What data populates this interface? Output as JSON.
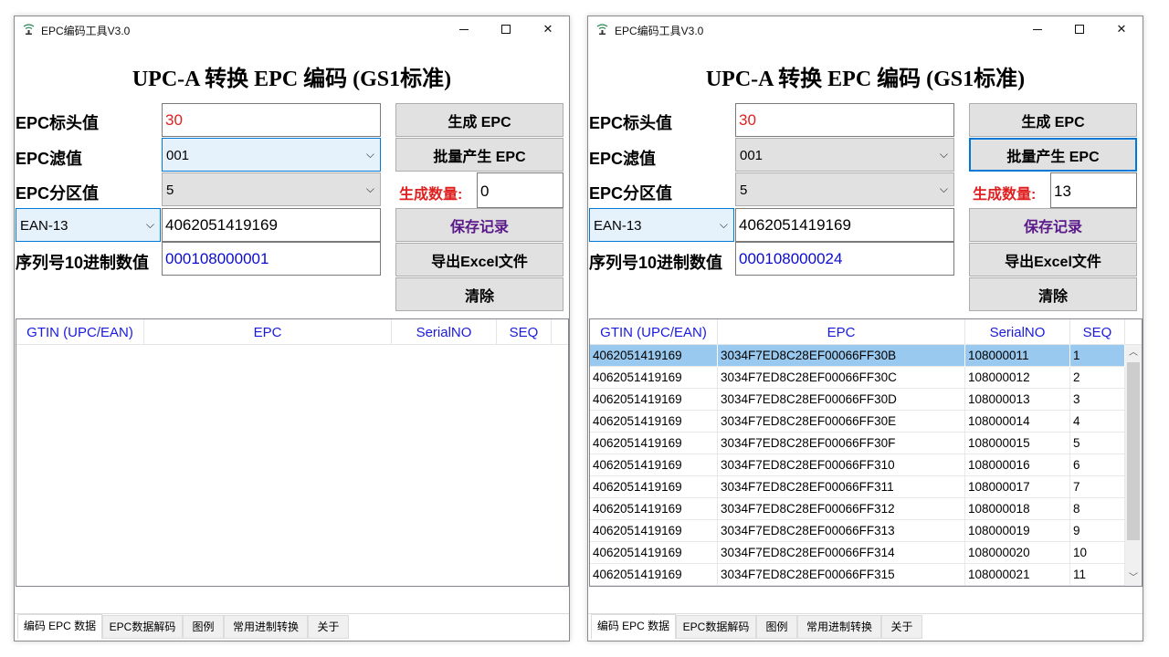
{
  "app": {
    "title": "EPC编码工具V3.0",
    "heading": "UPC-A 转换 EPC 编码 (GS1标准)"
  },
  "labels": {
    "epc_header": "EPC标头值",
    "epc_filter": "EPC滤值",
    "epc_partition": "EPC分区值",
    "serial_decimal": "序列号10进制数值",
    "quantity": "生成数量:"
  },
  "buttons": {
    "generate": "生成 EPC",
    "batch": "批量产生 EPC",
    "save": "保存记录",
    "export": "导出Excel文件",
    "clear": "清除"
  },
  "icons": {
    "dropdown": "chevron-down-icon",
    "scroll_up": "chevron-up-icon",
    "scroll_down": "chevron-down-icon",
    "app": "app-antenna-icon"
  },
  "grid_columns": [
    "GTIN (UPC/EAN)",
    "EPC",
    "SerialNO",
    "SEQ"
  ],
  "tabs": [
    "编码 EPC 数据",
    "EPC数据解码",
    "图例",
    "常用进制转换",
    "关于"
  ],
  "colors": {
    "header_value": "#e02020",
    "serial_value": "#0b0bd0",
    "column_header": "#1a1ae0",
    "save_label": "#5b1a8a",
    "selected_row": "#99c9ef",
    "focus_border": "#0078d7"
  },
  "windows": {
    "left": {
      "epc_header": "30",
      "epc_filter": "001",
      "epc_partition": "5",
      "code_type": "EAN-13",
      "gtin": "4062051419169",
      "serial": "000108000001",
      "quantity": "0",
      "rows": []
    },
    "right": {
      "epc_header": "30",
      "epc_filter": "001",
      "epc_partition": "5",
      "code_type": "EAN-13",
      "gtin": "4062051419169",
      "serial": "000108000024",
      "quantity": "13",
      "rows": [
        {
          "gtin": "4062051419169",
          "epc": "3034F7ED8C28EF00066FF30B",
          "serial": "108000011",
          "seq": "1"
        },
        {
          "gtin": "4062051419169",
          "epc": "3034F7ED8C28EF00066FF30C",
          "serial": "108000012",
          "seq": "2"
        },
        {
          "gtin": "4062051419169",
          "epc": "3034F7ED8C28EF00066FF30D",
          "serial": "108000013",
          "seq": "3"
        },
        {
          "gtin": "4062051419169",
          "epc": "3034F7ED8C28EF00066FF30E",
          "serial": "108000014",
          "seq": "4"
        },
        {
          "gtin": "4062051419169",
          "epc": "3034F7ED8C28EF00066FF30F",
          "serial": "108000015",
          "seq": "5"
        },
        {
          "gtin": "4062051419169",
          "epc": "3034F7ED8C28EF00066FF310",
          "serial": "108000016",
          "seq": "6"
        },
        {
          "gtin": "4062051419169",
          "epc": "3034F7ED8C28EF00066FF311",
          "serial": "108000017",
          "seq": "7"
        },
        {
          "gtin": "4062051419169",
          "epc": "3034F7ED8C28EF00066FF312",
          "serial": "108000018",
          "seq": "8"
        },
        {
          "gtin": "4062051419169",
          "epc": "3034F7ED8C28EF00066FF313",
          "serial": "108000019",
          "seq": "9"
        },
        {
          "gtin": "4062051419169",
          "epc": "3034F7ED8C28EF00066FF314",
          "serial": "108000020",
          "seq": "10"
        },
        {
          "gtin": "4062051419169",
          "epc": "3034F7ED8C28EF00066FF315",
          "serial": "108000021",
          "seq": "11"
        }
      ]
    }
  }
}
